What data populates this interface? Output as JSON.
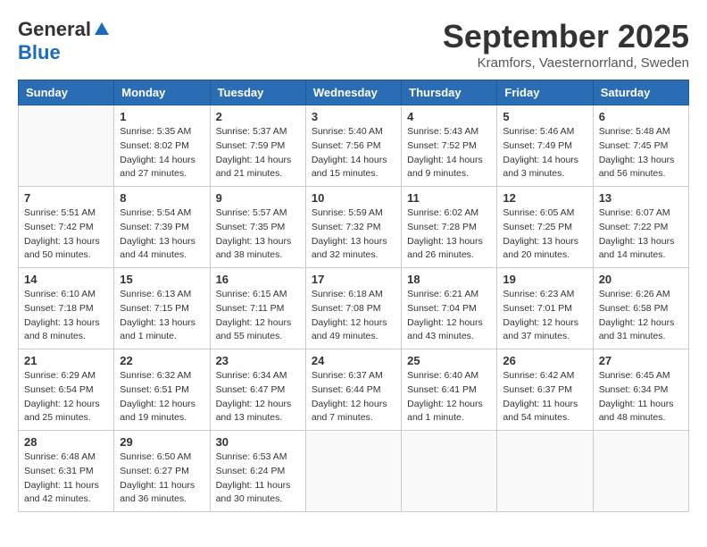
{
  "logo": {
    "general": "General",
    "blue": "Blue"
  },
  "title": "September 2025",
  "location": "Kramfors, Vaesternorrland, Sweden",
  "days_of_week": [
    "Sunday",
    "Monday",
    "Tuesday",
    "Wednesday",
    "Thursday",
    "Friday",
    "Saturday"
  ],
  "weeks": [
    [
      {
        "day": "",
        "info": ""
      },
      {
        "day": "1",
        "info": "Sunrise: 5:35 AM\nSunset: 8:02 PM\nDaylight: 14 hours\nand 27 minutes."
      },
      {
        "day": "2",
        "info": "Sunrise: 5:37 AM\nSunset: 7:59 PM\nDaylight: 14 hours\nand 21 minutes."
      },
      {
        "day": "3",
        "info": "Sunrise: 5:40 AM\nSunset: 7:56 PM\nDaylight: 14 hours\nand 15 minutes."
      },
      {
        "day": "4",
        "info": "Sunrise: 5:43 AM\nSunset: 7:52 PM\nDaylight: 14 hours\nand 9 minutes."
      },
      {
        "day": "5",
        "info": "Sunrise: 5:46 AM\nSunset: 7:49 PM\nDaylight: 14 hours\nand 3 minutes."
      },
      {
        "day": "6",
        "info": "Sunrise: 5:48 AM\nSunset: 7:45 PM\nDaylight: 13 hours\nand 56 minutes."
      }
    ],
    [
      {
        "day": "7",
        "info": "Sunrise: 5:51 AM\nSunset: 7:42 PM\nDaylight: 13 hours\nand 50 minutes."
      },
      {
        "day": "8",
        "info": "Sunrise: 5:54 AM\nSunset: 7:39 PM\nDaylight: 13 hours\nand 44 minutes."
      },
      {
        "day": "9",
        "info": "Sunrise: 5:57 AM\nSunset: 7:35 PM\nDaylight: 13 hours\nand 38 minutes."
      },
      {
        "day": "10",
        "info": "Sunrise: 5:59 AM\nSunset: 7:32 PM\nDaylight: 13 hours\nand 32 minutes."
      },
      {
        "day": "11",
        "info": "Sunrise: 6:02 AM\nSunset: 7:28 PM\nDaylight: 13 hours\nand 26 minutes."
      },
      {
        "day": "12",
        "info": "Sunrise: 6:05 AM\nSunset: 7:25 PM\nDaylight: 13 hours\nand 20 minutes."
      },
      {
        "day": "13",
        "info": "Sunrise: 6:07 AM\nSunset: 7:22 PM\nDaylight: 13 hours\nand 14 minutes."
      }
    ],
    [
      {
        "day": "14",
        "info": "Sunrise: 6:10 AM\nSunset: 7:18 PM\nDaylight: 13 hours\nand 8 minutes."
      },
      {
        "day": "15",
        "info": "Sunrise: 6:13 AM\nSunset: 7:15 PM\nDaylight: 13 hours\nand 1 minute."
      },
      {
        "day": "16",
        "info": "Sunrise: 6:15 AM\nSunset: 7:11 PM\nDaylight: 12 hours\nand 55 minutes."
      },
      {
        "day": "17",
        "info": "Sunrise: 6:18 AM\nSunset: 7:08 PM\nDaylight: 12 hours\nand 49 minutes."
      },
      {
        "day": "18",
        "info": "Sunrise: 6:21 AM\nSunset: 7:04 PM\nDaylight: 12 hours\nand 43 minutes."
      },
      {
        "day": "19",
        "info": "Sunrise: 6:23 AM\nSunset: 7:01 PM\nDaylight: 12 hours\nand 37 minutes."
      },
      {
        "day": "20",
        "info": "Sunrise: 6:26 AM\nSunset: 6:58 PM\nDaylight: 12 hours\nand 31 minutes."
      }
    ],
    [
      {
        "day": "21",
        "info": "Sunrise: 6:29 AM\nSunset: 6:54 PM\nDaylight: 12 hours\nand 25 minutes."
      },
      {
        "day": "22",
        "info": "Sunrise: 6:32 AM\nSunset: 6:51 PM\nDaylight: 12 hours\nand 19 minutes."
      },
      {
        "day": "23",
        "info": "Sunrise: 6:34 AM\nSunset: 6:47 PM\nDaylight: 12 hours\nand 13 minutes."
      },
      {
        "day": "24",
        "info": "Sunrise: 6:37 AM\nSunset: 6:44 PM\nDaylight: 12 hours\nand 7 minutes."
      },
      {
        "day": "25",
        "info": "Sunrise: 6:40 AM\nSunset: 6:41 PM\nDaylight: 12 hours\nand 1 minute."
      },
      {
        "day": "26",
        "info": "Sunrise: 6:42 AM\nSunset: 6:37 PM\nDaylight: 11 hours\nand 54 minutes."
      },
      {
        "day": "27",
        "info": "Sunrise: 6:45 AM\nSunset: 6:34 PM\nDaylight: 11 hours\nand 48 minutes."
      }
    ],
    [
      {
        "day": "28",
        "info": "Sunrise: 6:48 AM\nSunset: 6:31 PM\nDaylight: 11 hours\nand 42 minutes."
      },
      {
        "day": "29",
        "info": "Sunrise: 6:50 AM\nSunset: 6:27 PM\nDaylight: 11 hours\nand 36 minutes."
      },
      {
        "day": "30",
        "info": "Sunrise: 6:53 AM\nSunset: 6:24 PM\nDaylight: 11 hours\nand 30 minutes."
      },
      {
        "day": "",
        "info": ""
      },
      {
        "day": "",
        "info": ""
      },
      {
        "day": "",
        "info": ""
      },
      {
        "day": "",
        "info": ""
      }
    ]
  ]
}
